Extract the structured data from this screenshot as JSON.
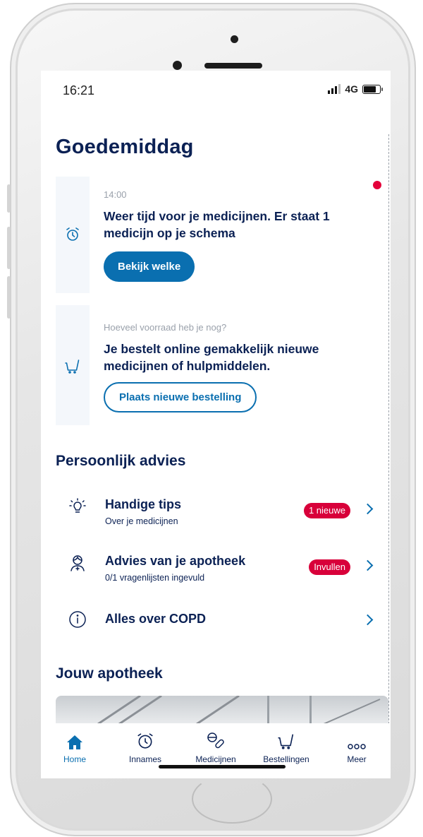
{
  "status_bar": {
    "time": "16:21",
    "network": "4G"
  },
  "greeting": "Goedemiddag",
  "reminder_card": {
    "time": "14:00",
    "title": "Weer tijd voor je medicijnen. Er staat 1 medicijn op je schema",
    "button": "Bekijk welke",
    "icon": "alarm-clock-icon"
  },
  "order_card": {
    "meta": "Hoeveel voorraad heb je nog?",
    "title": "Je bestelt online gemakkelijk nieuwe medicijnen of hulpmiddelen.",
    "button": "Plaats nieuwe bestelling",
    "icon": "cart-icon"
  },
  "advice": {
    "heading": "Persoonlijk advies",
    "items": [
      {
        "title": "Handige tips",
        "subtitle": "Over je medicijnen",
        "badge": "1 nieuwe",
        "icon": "lightbulb-icon"
      },
      {
        "title": "Advies van je apotheek",
        "subtitle": "0/1 vragenlijsten ingevuld",
        "badge": "Invullen",
        "icon": "pharmacist-icon"
      },
      {
        "title": "Alles over COPD",
        "subtitle": "",
        "badge": "",
        "icon": "info-icon"
      }
    ]
  },
  "pharmacy": {
    "heading": "Jouw apotheek"
  },
  "tabbar": {
    "tabs": [
      {
        "label": "Home",
        "icon": "home-icon",
        "active": true
      },
      {
        "label": "Innames",
        "icon": "alarm-clock-icon",
        "active": false
      },
      {
        "label": "Medicijnen",
        "icon": "pills-icon",
        "active": false
      },
      {
        "label": "Bestellingen",
        "icon": "cart-icon",
        "active": false
      },
      {
        "label": "Meer",
        "icon": "more-icon",
        "active": false
      }
    ]
  },
  "colors": {
    "navy": "#0b2154",
    "primary": "#0a6fb0",
    "badge_red": "#d8003a",
    "notification_dot": "#e4003a"
  }
}
